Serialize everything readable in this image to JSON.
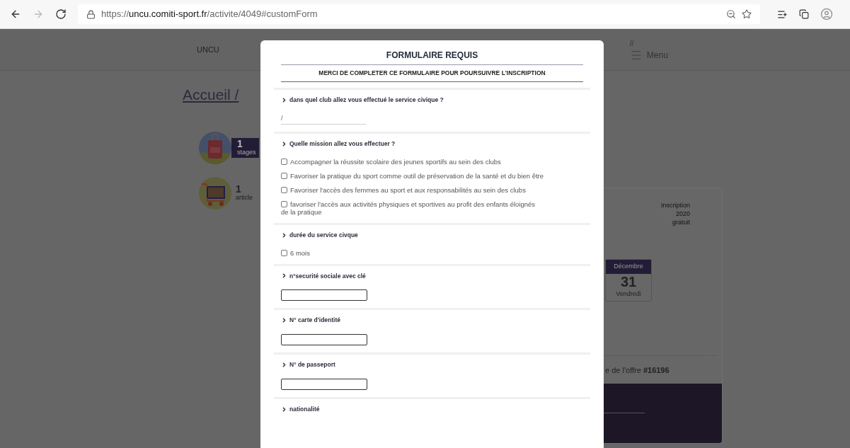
{
  "browser": {
    "url_scheme": "https://",
    "url_host": "uncu.comiti-sport.fr",
    "url_path": "/activite/4049#customForm"
  },
  "header": {
    "brand": "UNCU",
    "slashes": "//",
    "menu": "Menu"
  },
  "breadcrumb": "Accueil /",
  "counters": [
    {
      "kind": "suitcase",
      "count": "1",
      "label": "stages"
    },
    {
      "kind": "cart",
      "count": "1",
      "label": "article"
    }
  ],
  "card": {
    "info": [
      "Inscription",
      "2020",
      "gratuit"
    ],
    "calendar": {
      "month": "Décembre",
      "day": "31",
      "weekday": "Vendredi"
    },
    "offer": "e de l'offre **#16196**"
  },
  "modal": {
    "title": "FORMULAIRE REQUIS",
    "subtitle": "MERCI DE COMPLETER CE FORMULAIRE POUR POURSUIVRE L'INSCRIPTION",
    "questions": [
      {
        "label": "dans quel club allez vous effectué le service civique ?",
        "kind": "line",
        "value": "/"
      },
      {
        "label": "Quelle mission allez vous effectuer ?",
        "kind": "checkboxes",
        "options": [
          {
            "label": "Accompagner la réussite scolaire des jeunes sportifs au sein des clubs",
            "checked": false
          },
          {
            "label": "Favoriser la pratique du sport comme outil de préservation de la santé et du bien être",
            "checked": false
          },
          {
            "label": "Favoriser l'accès des femmes au sport et aux responsabilités au sein des clubs",
            "checked": false
          },
          {
            "label": "favoriser l'accès aux activités physiques et sportives au profit des enfants éloignés de la pratique",
            "checked": false
          }
        ]
      },
      {
        "label": "durée du service civque",
        "kind": "checkboxes",
        "options": [
          {
            "label": "6 mois",
            "checked": false
          }
        ]
      },
      {
        "label": "n°securité sociale avec clé",
        "kind": "box"
      },
      {
        "label": "N° carte d'identité",
        "kind": "box"
      },
      {
        "label": "N° de passeport",
        "kind": "box"
      },
      {
        "label": "nationalité",
        "kind": "cut"
      }
    ]
  }
}
